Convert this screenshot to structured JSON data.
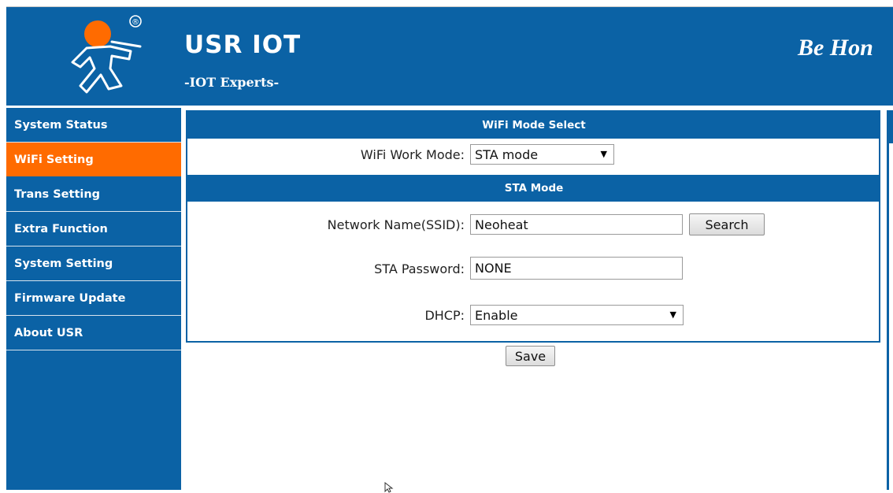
{
  "header": {
    "title": "USR IOT",
    "subtitle": "-IOT Experts-",
    "slogan": "Be Hon",
    "registered_mark": "®",
    "colors": {
      "brand_blue": "#0b62a5",
      "accent_orange": "#ff6b00"
    }
  },
  "sidebar": {
    "items": [
      {
        "label": "System Status",
        "active": false
      },
      {
        "label": "WiFi Setting",
        "active": true
      },
      {
        "label": "Trans Setting",
        "active": false
      },
      {
        "label": "Extra Function",
        "active": false
      },
      {
        "label": "System Setting",
        "active": false
      },
      {
        "label": "Firmware Update",
        "active": false
      },
      {
        "label": "About USR",
        "active": false
      }
    ]
  },
  "wifi_mode": {
    "section_title": "WiFi Mode Select",
    "work_mode_label": "WiFi Work Mode:",
    "work_mode_value": "STA mode"
  },
  "sta_mode": {
    "section_title": "STA Mode",
    "ssid_label": "Network Name(SSID):",
    "ssid_value": "Neoheat",
    "search_label": "Search",
    "password_label": "STA Password:",
    "password_value": "NONE",
    "dhcp_label": "DHCP:",
    "dhcp_value": "Enable"
  },
  "actions": {
    "save_label": "Save"
  },
  "icons": {
    "select_arrow": "▼",
    "logo": "running-man-logo-icon",
    "cursor": "mouse-cursor-icon"
  }
}
